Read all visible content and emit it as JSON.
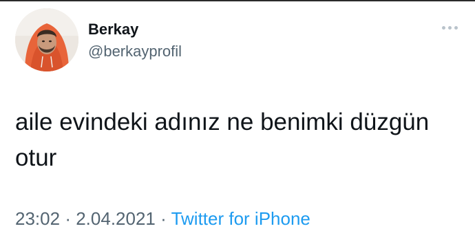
{
  "tweet": {
    "author": {
      "display_name": "Berkay",
      "handle": "@berkayprofil"
    },
    "text": "aile evindeki adınız ne benimki düzgün otur",
    "time": "23:02",
    "separator": "·",
    "date": "2.04.2021",
    "source": "Twitter for iPhone",
    "more_icon": "more-horizontal-icon"
  },
  "colors": {
    "text_primary": "#0f1419",
    "text_secondary": "#536471",
    "link": "#1d9bf0",
    "avatar_hoodie": "#e8643a"
  }
}
